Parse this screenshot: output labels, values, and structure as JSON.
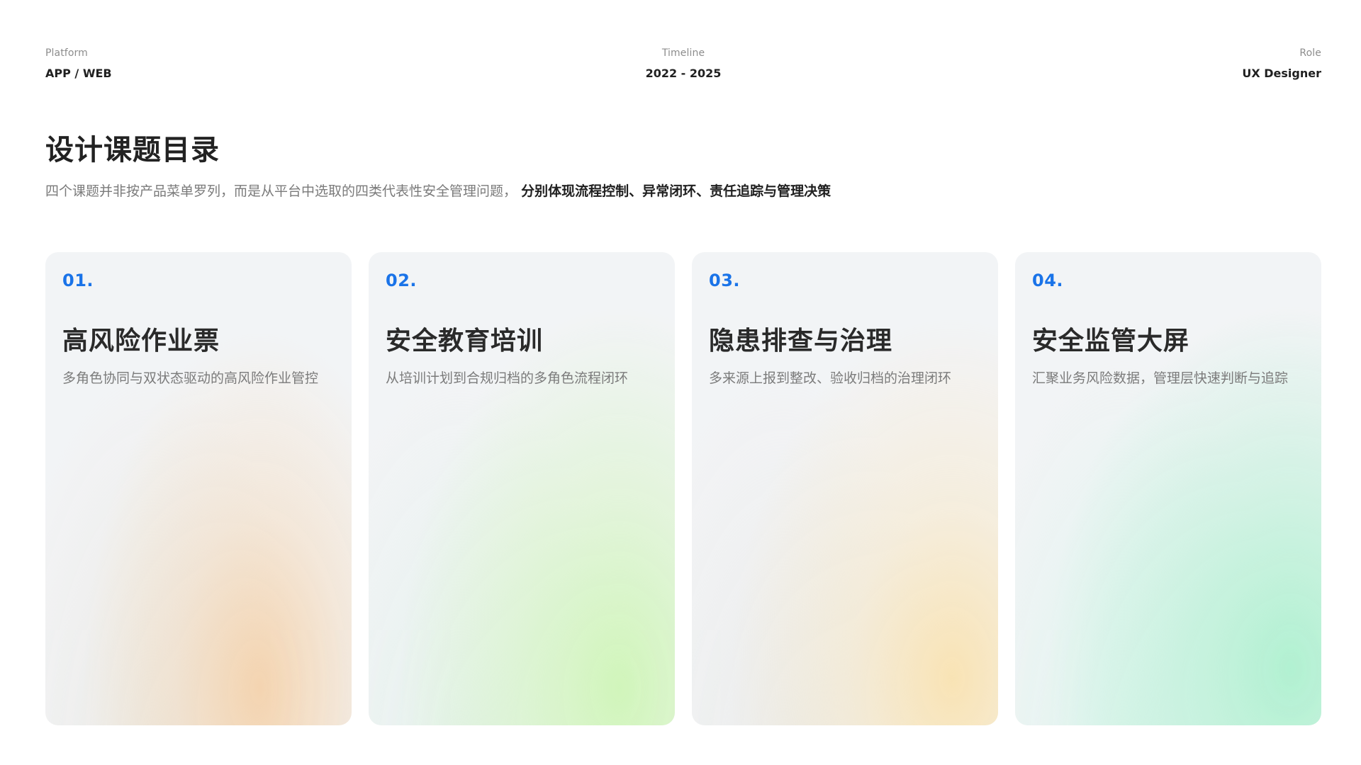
{
  "meta": {
    "platform_label": "Platform",
    "platform_value": "APP / WEB",
    "timeline_label": "Timeline",
    "timeline_value": "2022 - 2025",
    "role_label": "Role",
    "role_value": "UX Designer"
  },
  "page": {
    "title": "设计课题目录",
    "subtitle_prefix": "四个课题并非按产品菜单罗列，而是从平台中选取的四类代表性安全管理问题，",
    "subtitle_emphasis": "分别体现流程控制、异常闭环、责任追踪与管理决策"
  },
  "cards": [
    {
      "number": "01.",
      "title": "高风险作业票",
      "description": "多角色协同与双状态驱动的高风险作业管控"
    },
    {
      "number": "02.",
      "title": "安全教育培训",
      "description": "从培训计划到合规归档的多角色流程闭环"
    },
    {
      "number": "03.",
      "title": "隐患排查与治理",
      "description": "多来源上报到整改、验收归档的治理闭环"
    },
    {
      "number": "04.",
      "title": "安全监管大屏",
      "description": "汇聚业务风险数据，管理层快速判断与追踪"
    }
  ],
  "colors": {
    "accent": "#1a73e8",
    "title": "#222222",
    "muted": "#7a7a7a",
    "card_bg": "#f2f4f6"
  }
}
